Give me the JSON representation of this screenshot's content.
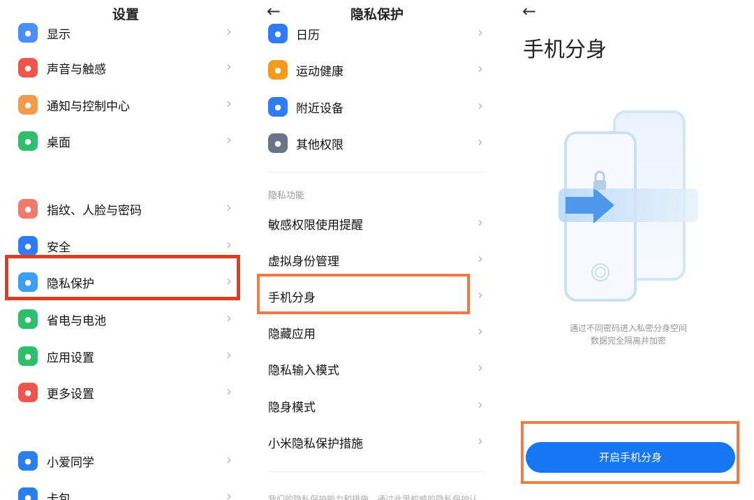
{
  "settings": {
    "title": "设置",
    "items": [
      {
        "label": "显示",
        "icon": "display-icon",
        "color": "#4c8dff"
      },
      {
        "label": "声音与触感",
        "icon": "speaker-icon",
        "color": "#f0554c"
      },
      {
        "label": "通知与控制中心",
        "icon": "notification-icon",
        "color": "#f39b4a"
      },
      {
        "label": "桌面",
        "icon": "home-icon",
        "color": "#2fbf6c"
      },
      {
        "label": "指纹、人脸与密码",
        "icon": "fingerprint-icon",
        "color": "#f07a6b"
      },
      {
        "label": "安全",
        "icon": "shield-icon",
        "color": "#2e7cf6"
      },
      {
        "label": "隐私保护",
        "icon": "privacy-icon",
        "color": "#3a9ff5"
      },
      {
        "label": "省电与电池",
        "icon": "battery-icon",
        "color": "#2fbf6c"
      },
      {
        "label": "应用设置",
        "icon": "gear-icon",
        "color": "#2fbf6c"
      },
      {
        "label": "更多设置",
        "icon": "more-icon",
        "color": "#f0554c"
      },
      {
        "label": "小爱同学",
        "icon": "xiaoai-icon",
        "color": "#2a7ff0"
      },
      {
        "label": "卡包",
        "icon": "card-icon",
        "color": "#2a7ff0"
      }
    ]
  },
  "privacy": {
    "title": "隐私保护",
    "perm_items": [
      {
        "label": "日历",
        "icon": "calendar-icon",
        "color": "#2f7cf6"
      },
      {
        "label": "运动健康",
        "icon": "running-icon",
        "color": "#f39b1c"
      },
      {
        "label": "附近设备",
        "icon": "device-icon",
        "color": "#2f7cf6"
      },
      {
        "label": "其他权限",
        "icon": "more-icon",
        "color": "#6b7486"
      }
    ],
    "section_label": "隐私功能",
    "feature_items": [
      {
        "label": "敏感权限使用提醒"
      },
      {
        "label": "虚拟身份管理"
      },
      {
        "label": "手机分身"
      },
      {
        "label": "隐藏应用"
      },
      {
        "label": "隐私输入模式"
      },
      {
        "label": "隐身模式"
      },
      {
        "label": "小米隐私保护措施"
      }
    ],
    "footer_truncated": "我们的隐私保护能力和措施，通过此里权威的隐私保护认"
  },
  "clone": {
    "title": "手机分身",
    "desc_line1": "通过不同密码进入私密分身空间",
    "desc_line2": "数据完全隔离并加密",
    "button": "开启手机分身"
  },
  "glyphs": {
    "back": "←",
    "chevron": "›"
  }
}
